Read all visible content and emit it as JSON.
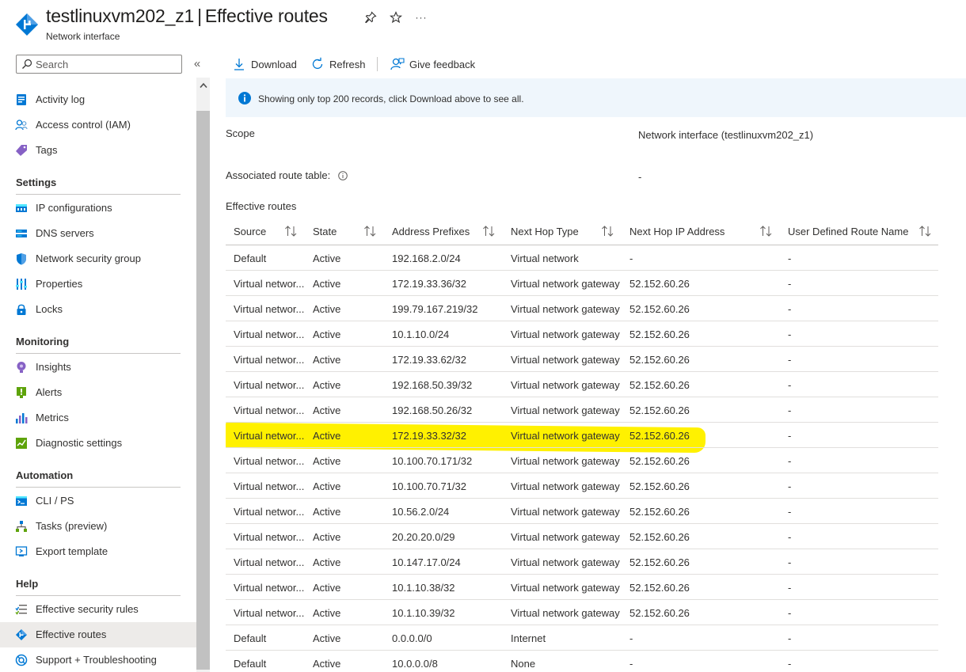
{
  "header": {
    "resource_name": "testlinuxvm202_z1",
    "separator": "|",
    "blade_title": "Effective routes",
    "subtitle": "Network interface",
    "pin_icon": "pin-icon",
    "favorite_icon": "star-icon",
    "more_label": "···"
  },
  "sidebar": {
    "search_placeholder": "Search",
    "collapse_label": "«",
    "top_items": [
      {
        "label": "Activity log",
        "icon": "activity-log-icon"
      },
      {
        "label": "Access control (IAM)",
        "icon": "iam-icon"
      },
      {
        "label": "Tags",
        "icon": "tag-icon"
      }
    ],
    "sections": [
      {
        "title": "Settings",
        "items": [
          {
            "label": "IP configurations",
            "icon": "ip-config-icon"
          },
          {
            "label": "DNS servers",
            "icon": "dns-icon"
          },
          {
            "label": "Network security group",
            "icon": "shield-icon"
          },
          {
            "label": "Properties",
            "icon": "properties-icon"
          },
          {
            "label": "Locks",
            "icon": "lock-icon"
          }
        ]
      },
      {
        "title": "Monitoring",
        "items": [
          {
            "label": "Insights",
            "icon": "insights-icon"
          },
          {
            "label": "Alerts",
            "icon": "alerts-icon"
          },
          {
            "label": "Metrics",
            "icon": "metrics-icon"
          },
          {
            "label": "Diagnostic settings",
            "icon": "diagnostic-icon"
          }
        ]
      },
      {
        "title": "Automation",
        "items": [
          {
            "label": "CLI / PS",
            "icon": "cli-icon"
          },
          {
            "label": "Tasks (preview)",
            "icon": "tasks-icon"
          },
          {
            "label": "Export template",
            "icon": "export-icon"
          }
        ]
      },
      {
        "title": "Help",
        "items": [
          {
            "label": "Effective security rules",
            "icon": "security-rules-icon"
          },
          {
            "label": "Effective routes",
            "icon": "routes-icon",
            "active": true
          },
          {
            "label": "Support + Troubleshooting",
            "icon": "support-icon"
          }
        ]
      }
    ]
  },
  "toolbar": {
    "download_label": "Download",
    "refresh_label": "Refresh",
    "feedback_label": "Give feedback"
  },
  "banner": {
    "text": "Showing only top 200 records, click Download above to see all."
  },
  "properties": {
    "scope_label": "Scope",
    "scope_value": "Network interface (testlinuxvm202_z1)",
    "route_table_label": "Associated route table:",
    "route_table_value": "-",
    "section_title": "Effective routes"
  },
  "table": {
    "columns": [
      "Source",
      "State",
      "Address Prefixes",
      "Next Hop Type",
      "Next Hop IP Address",
      "User Defined Route Name"
    ],
    "rows": [
      [
        "Default",
        "Active",
        "192.168.2.0/24",
        "Virtual network",
        "-",
        "-"
      ],
      [
        "Virtual networ...",
        "Active",
        "172.19.33.36/32",
        "Virtual network gateway",
        "52.152.60.26",
        "-"
      ],
      [
        "Virtual networ...",
        "Active",
        "199.79.167.219/32",
        "Virtual network gateway",
        "52.152.60.26",
        "-"
      ],
      [
        "Virtual networ...",
        "Active",
        "10.1.10.0/24",
        "Virtual network gateway",
        "52.152.60.26",
        "-"
      ],
      [
        "Virtual networ...",
        "Active",
        "172.19.33.62/32",
        "Virtual network gateway",
        "52.152.60.26",
        "-"
      ],
      [
        "Virtual networ...",
        "Active",
        "192.168.50.39/32",
        "Virtual network gateway",
        "52.152.60.26",
        "-"
      ],
      [
        "Virtual networ...",
        "Active",
        "192.168.50.26/32",
        "Virtual network gateway",
        "52.152.60.26",
        "-"
      ],
      [
        "Virtual networ...",
        "Active",
        "172.19.33.32/32",
        "Virtual network gateway",
        "52.152.60.26",
        "-"
      ],
      [
        "Virtual networ...",
        "Active",
        "10.100.70.171/32",
        "Virtual network gateway",
        "52.152.60.26",
        "-"
      ],
      [
        "Virtual networ...",
        "Active",
        "10.100.70.71/32",
        "Virtual network gateway",
        "52.152.60.26",
        "-"
      ],
      [
        "Virtual networ...",
        "Active",
        "10.56.2.0/24",
        "Virtual network gateway",
        "52.152.60.26",
        "-"
      ],
      [
        "Virtual networ...",
        "Active",
        "20.20.20.0/29",
        "Virtual network gateway",
        "52.152.60.26",
        "-"
      ],
      [
        "Virtual networ...",
        "Active",
        "10.147.17.0/24",
        "Virtual network gateway",
        "52.152.60.26",
        "-"
      ],
      [
        "Virtual networ...",
        "Active",
        "10.1.10.38/32",
        "Virtual network gateway",
        "52.152.60.26",
        "-"
      ],
      [
        "Virtual networ...",
        "Active",
        "10.1.10.39/32",
        "Virtual network gateway",
        "52.152.60.26",
        "-"
      ],
      [
        "Default",
        "Active",
        "0.0.0.0/0",
        "Internet",
        "-",
        "-"
      ],
      [
        "Default",
        "Active",
        "10.0.0.0/8",
        "None",
        "-",
        "-"
      ]
    ],
    "highlighted_row": 7
  },
  "colors": {
    "accent": "#0078d4",
    "highlight": "#fff100",
    "banner_bg": "#eff6fc",
    "active_nav_bg": "#edebe9"
  }
}
